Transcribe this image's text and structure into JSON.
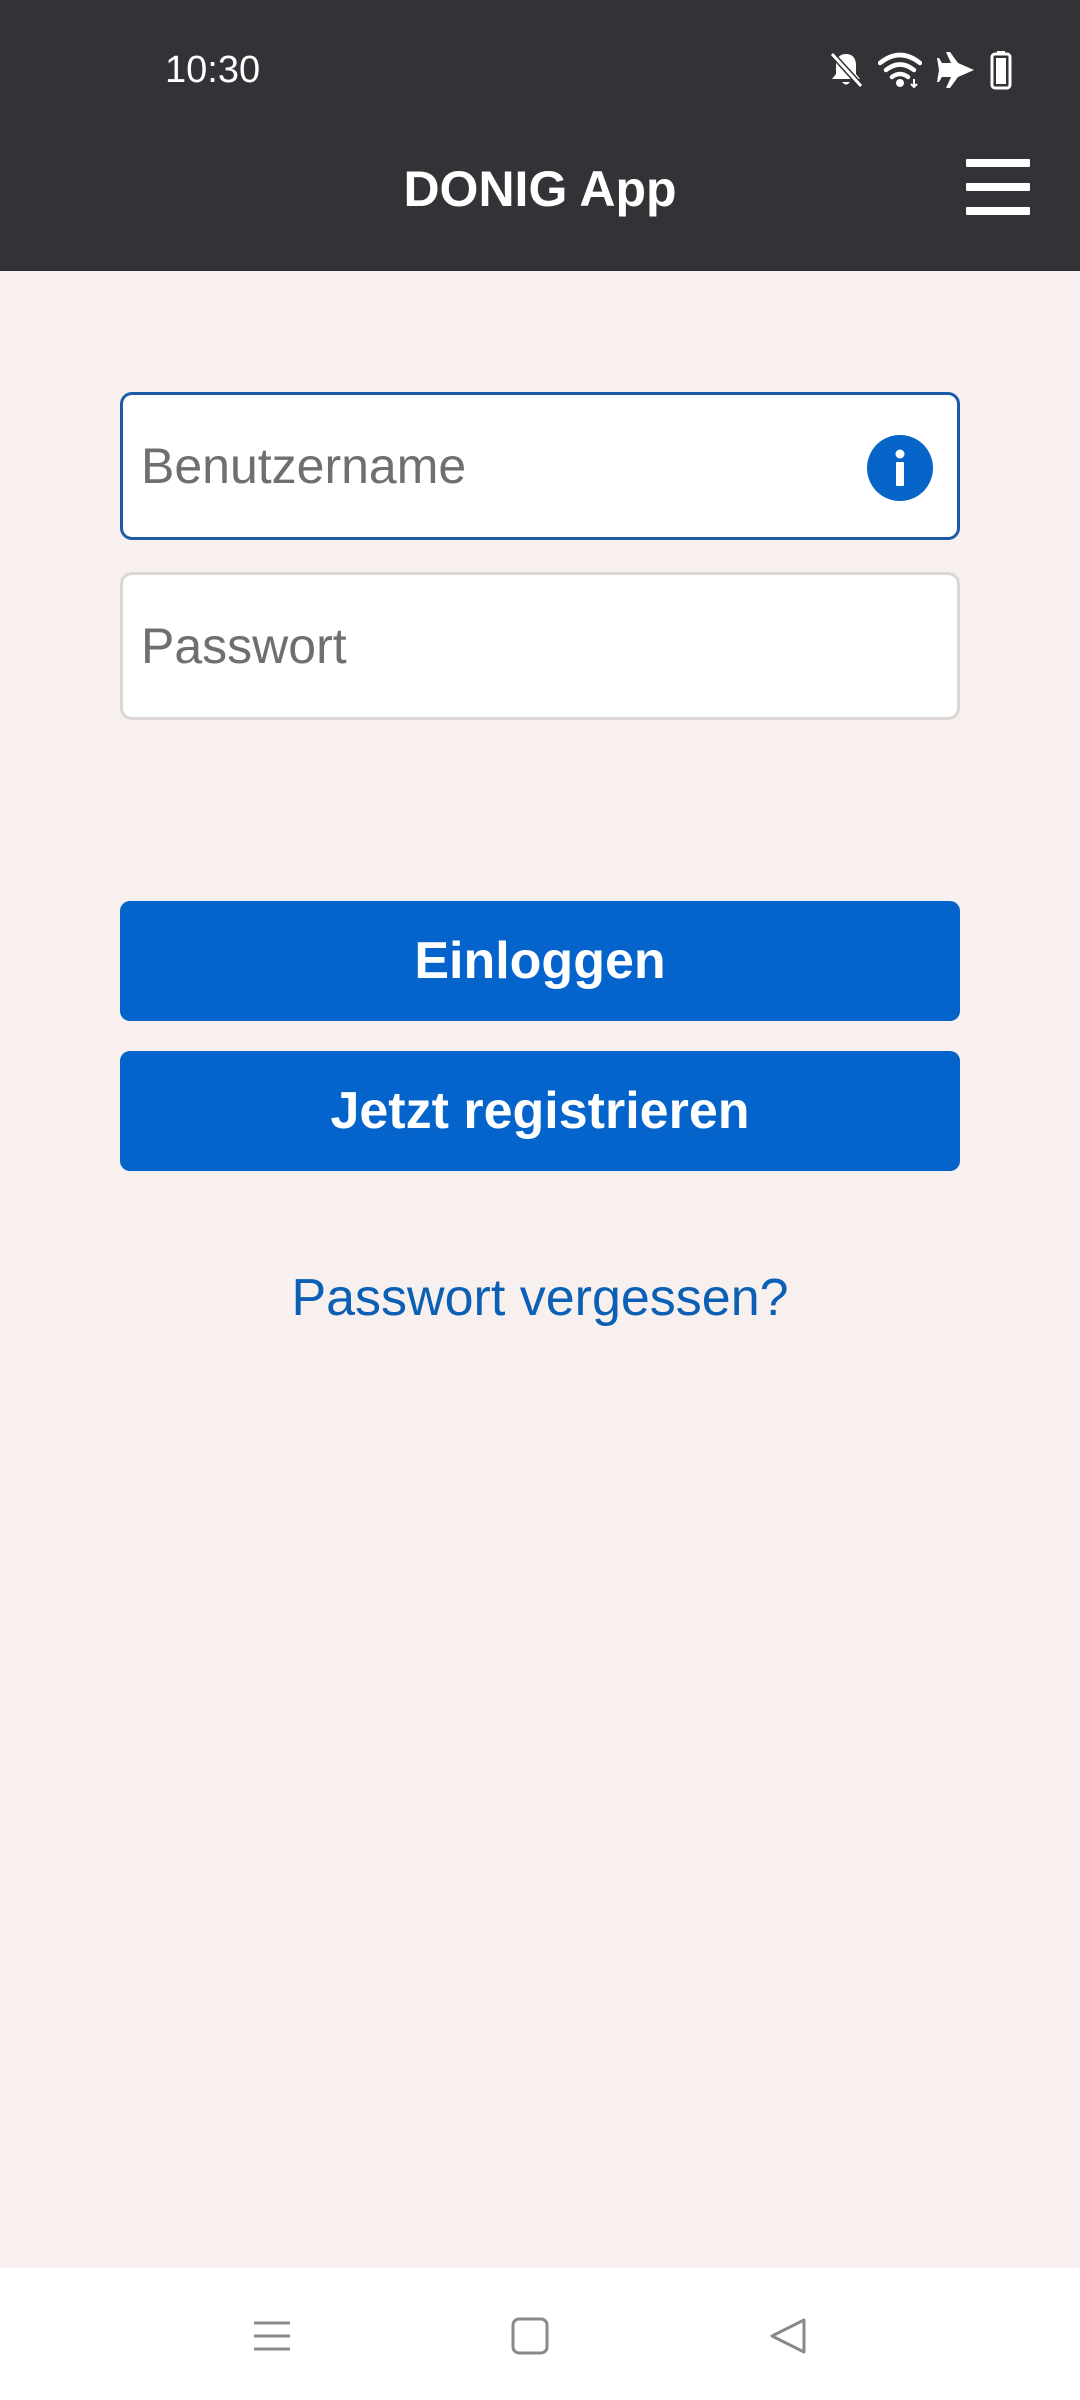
{
  "status_bar": {
    "time": "10:30",
    "icons": [
      "notifications-off-icon",
      "wifi-icon",
      "airplane-icon",
      "battery-icon"
    ]
  },
  "header": {
    "title": "DONIG App",
    "menu_icon": "hamburger-menu-icon"
  },
  "form": {
    "username_placeholder": "Benutzername",
    "password_placeholder": "Passwort",
    "info_icon": "info-icon"
  },
  "actions": {
    "login_label": "Einloggen",
    "register_label": "Jetzt registrieren",
    "forgot_password_label": "Passwort vergessen?"
  },
  "nav_bar": {
    "icons": [
      "recents-icon",
      "home-icon",
      "back-icon"
    ]
  },
  "colors": {
    "header_bg": "#333236",
    "page_bg": "#f7f0ef",
    "primary": "#0564cc",
    "link": "#0b5fb5",
    "focus_border": "#1e5ba6"
  }
}
